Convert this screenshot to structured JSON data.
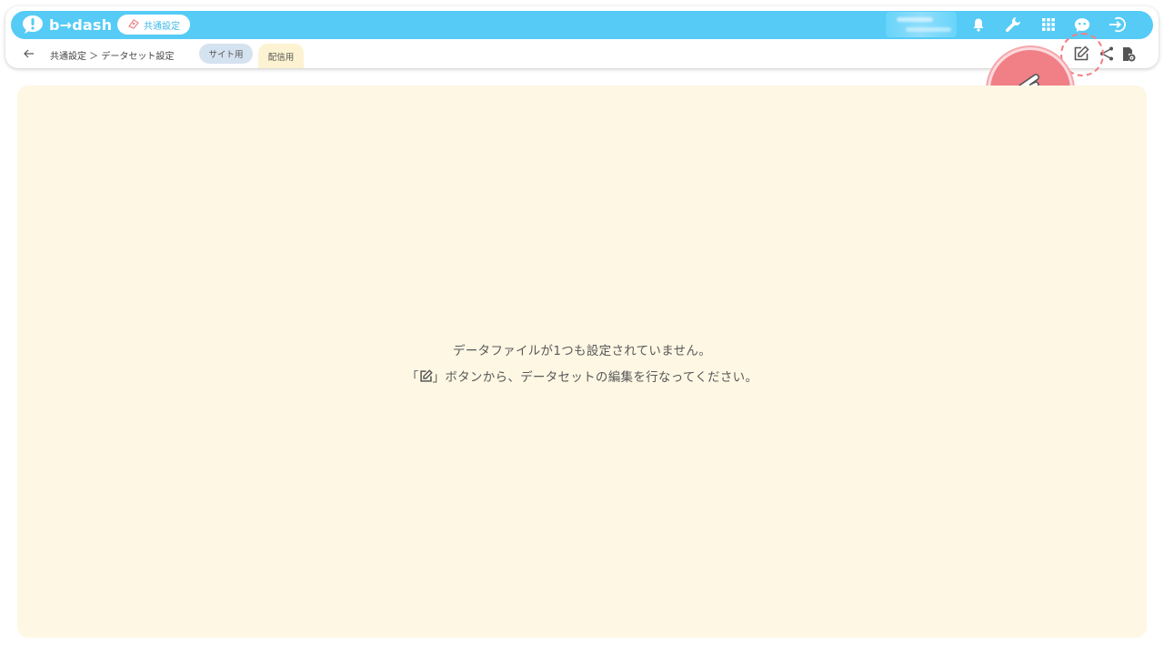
{
  "header": {
    "logo_text": "b→dash",
    "mode_label": "共通設定",
    "icons": [
      "bell-icon",
      "wrench-icon",
      "apps-grid-icon",
      "assistant-icon",
      "logout-icon"
    ]
  },
  "subbar": {
    "breadcrumb": "共通設定 ＞ データセット設定",
    "tabs": [
      {
        "label": "サイト用",
        "active": false
      },
      {
        "label": "配信用",
        "active": true
      }
    ],
    "actions": [
      "edit-icon",
      "share-icon",
      "file-settings-icon"
    ]
  },
  "main": {
    "empty_line1": "データファイルが1つも設定されていません。",
    "empty_line2_prefix": "「",
    "empty_line2_suffix": "」ボタンから、データセットの編集を行なってください。"
  },
  "colors": {
    "header_bg": "#55cbf6",
    "panel_bg": "#fdf7e4",
    "highlight": "#f07f86"
  }
}
